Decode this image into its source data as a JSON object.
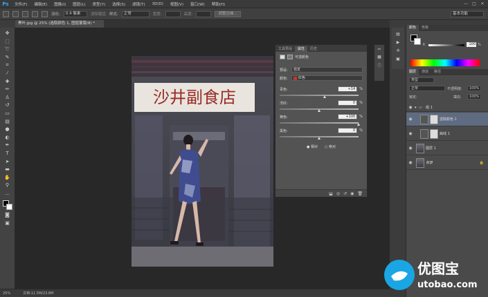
{
  "menubar": {
    "app_logo": "Ps",
    "items": [
      "文件(F)",
      "编辑(E)",
      "图像(I)",
      "图层(L)",
      "类型(Y)",
      "选择(S)",
      "滤镜(T)",
      "3D(D)",
      "视图(V)",
      "窗口(W)",
      "帮助(H)"
    ],
    "controls": [
      "—",
      "□",
      "✕"
    ]
  },
  "options_bar": {
    "feather_label": "羽化:",
    "feather_value": "0.4 像素",
    "antialias_label": "消除锯齿",
    "style_label": "样式:",
    "style_value": "正常",
    "width_label": "宽度:",
    "height_label": "高度:",
    "refine_edge_label": "调整边缘...",
    "workspace_value": "基本功能"
  },
  "document_tab": {
    "title": "黑叶.jpg @ 25% (选取颜色 1, 图层蒙版/8) *"
  },
  "status_bar": {
    "zoom": "25%",
    "doc_size": "文档:11.5M/23.8M"
  },
  "properties_panel": {
    "tabs": [
      "工具预设",
      "属性",
      "历史"
    ],
    "active_tab": "属性",
    "header_title": "可选颜色",
    "preset_label": "预设:",
    "preset_value": "自定",
    "colors_label": "颜色:",
    "colors_value": "红色",
    "colors_swatch": "#c0392b",
    "sliders": [
      {
        "label": "青色:",
        "value": "+14",
        "unit": "%",
        "pos": 0.57
      },
      {
        "label": "洋红:",
        "value": "0",
        "unit": "%",
        "pos": 0.5
      },
      {
        "label": "黄色:",
        "value": "+100",
        "unit": "%",
        "pos": 1.0
      },
      {
        "label": "黑色:",
        "value": "0",
        "unit": "%",
        "pos": 0.5
      }
    ],
    "method_relative": "相对",
    "method_absolute": "绝对"
  },
  "color_panel": {
    "tabs": [
      "颜色",
      "色板"
    ],
    "k_label": "K",
    "k_value": "100",
    "k_unit": "%"
  },
  "layers_panel": {
    "tabs": [
      "图层",
      "通道",
      "路径"
    ],
    "kind_value": "类型",
    "blend_value": "正常",
    "opacity_label": "不透明度:",
    "opacity_value": "100%",
    "lock_label": "锁定:",
    "fill_label": "填充:",
    "fill_value": "100%",
    "layers": [
      {
        "name": "组 1",
        "type": "group"
      },
      {
        "name": "选取颜色 1",
        "type": "adjustment",
        "selected": true
      },
      {
        "name": "曲线 1",
        "type": "adjustment"
      },
      {
        "name": "图层 1",
        "type": "pixel"
      },
      {
        "name": "背景",
        "type": "background"
      }
    ]
  },
  "photo": {
    "sign_text": "沙井副食店"
  },
  "watermark": {
    "brand": "优图宝",
    "url": "utobao.com"
  }
}
